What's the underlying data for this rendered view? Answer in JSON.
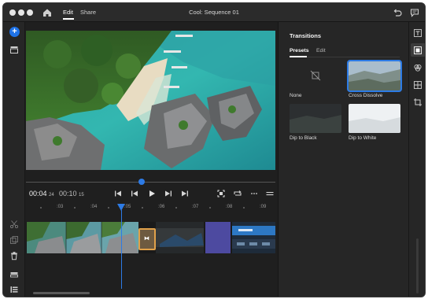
{
  "titlebar": {
    "tabs": [
      {
        "label": "Edit"
      },
      {
        "label": "Share"
      }
    ],
    "document_title": "Cool: Sequence 01"
  },
  "playback": {
    "current_time": "00:04",
    "current_frames": "24",
    "duration": "00:10",
    "duration_frames": "15"
  },
  "timeline": {
    "ruler_ticks": [
      ":03",
      ":04",
      ":05",
      ":06",
      ":07",
      ":08",
      ":09"
    ]
  },
  "transitions_panel": {
    "title": "Transitions",
    "tabs": [
      {
        "label": "Presets"
      },
      {
        "label": "Edit"
      }
    ],
    "items": [
      {
        "label": "None",
        "icon": "no-transition-icon"
      },
      {
        "label": "Cross Dissolve",
        "selected": true
      },
      {
        "label": "Dip to Black"
      },
      {
        "label": "Dip to White"
      }
    ]
  },
  "colors": {
    "accent": "#2d7be5",
    "transition_marker": "#e0a14a",
    "app_background": "#1f1f1f"
  }
}
